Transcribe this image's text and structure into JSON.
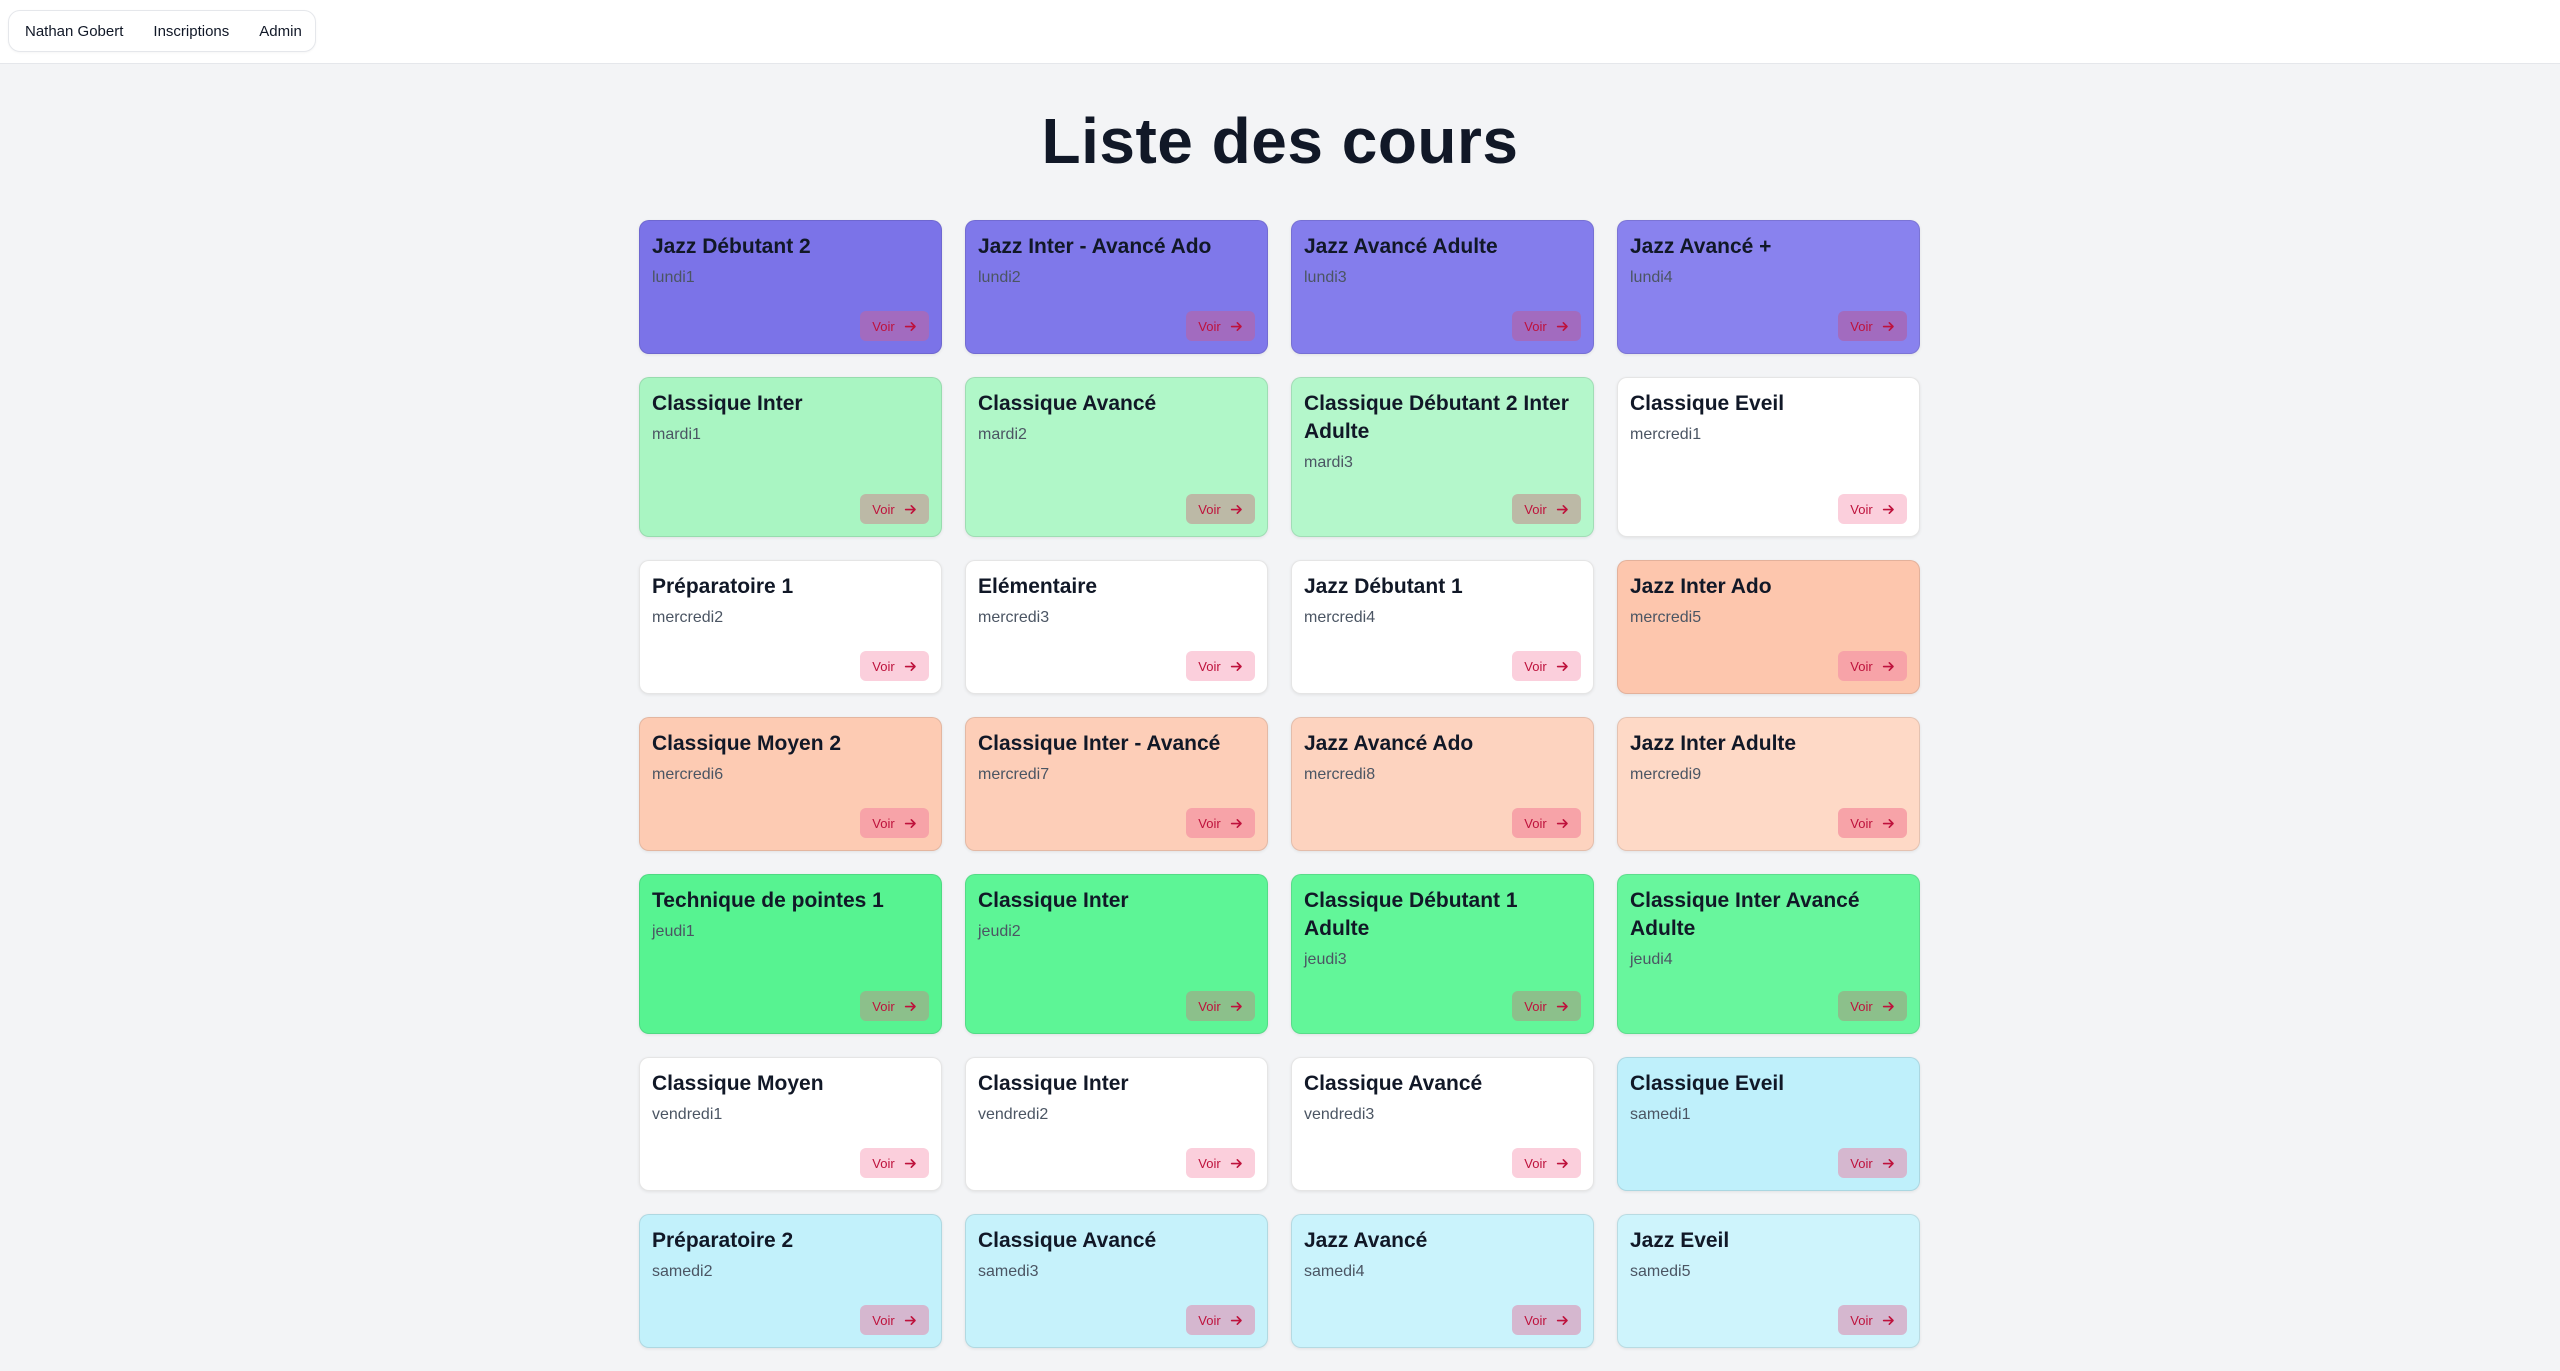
{
  "nav": {
    "items": [
      {
        "label": "Nathan Gobert"
      },
      {
        "label": "Inscriptions"
      },
      {
        "label": "Admin"
      }
    ]
  },
  "page": {
    "title": "Liste des cours"
  },
  "voir_label": "Voir",
  "courses": [
    {
      "title": "Jazz Débutant 2",
      "code": "lundi1",
      "color": "#7b73e8",
      "button_color": "#a26bbf"
    },
    {
      "title": "Jazz Inter - Avancé Ado",
      "code": "lundi2",
      "color": "#7f78ea",
      "button_color": "#a26bbf"
    },
    {
      "title": "Jazz Avancé Adulte",
      "code": "lundi3",
      "color": "#847dec",
      "button_color": "#a26bbf"
    },
    {
      "title": "Jazz Avancé +",
      "code": "lundi4",
      "color": "#8982ee",
      "button_color": "#a26bbf"
    },
    {
      "title": "Classique Inter",
      "code": "mardi1",
      "color": "#a9f5c2",
      "button_color": "#bcb9a6"
    },
    {
      "title": "Classique Avancé",
      "code": "mardi2",
      "color": "#b0f7c8",
      "button_color": "#bcb9a6"
    },
    {
      "title": "Classique Débutant 2 Inter Adulte",
      "code": "mardi3",
      "color": "#b4f7cb",
      "button_color": "#bcb9a6"
    },
    {
      "title": "Classique Eveil",
      "code": "mercredi1",
      "color": "#ffffff",
      "button_color": "#fbcfdc"
    },
    {
      "title": "Préparatoire 1",
      "code": "mercredi2",
      "color": "#ffffff",
      "button_color": "#fbcfdc"
    },
    {
      "title": "Elémentaire",
      "code": "mercredi3",
      "color": "#ffffff",
      "button_color": "#fbcfdc"
    },
    {
      "title": "Jazz Débutant 1",
      "code": "mercredi4",
      "color": "#ffffff",
      "button_color": "#fbcfdc"
    },
    {
      "title": "Jazz Inter Ado",
      "code": "mercredi5",
      "color": "#fdc6ad",
      "button_color": "#f7a3a8"
    },
    {
      "title": "Classique Moyen 2",
      "code": "mercredi6",
      "color": "#fdcbb3",
      "button_color": "#f7a3a8"
    },
    {
      "title": "Classique Inter - Avancé",
      "code": "mercredi7",
      "color": "#fdceb8",
      "button_color": "#f7a3a8"
    },
    {
      "title": "Jazz Avancé Ado",
      "code": "mercredi8",
      "color": "#fdd3bf",
      "button_color": "#f7a3a8"
    },
    {
      "title": "Jazz Inter Adulte",
      "code": "mercredi9",
      "color": "#fed9c6",
      "button_color": "#f7a3a8"
    },
    {
      "title": "Technique de pointes 1",
      "code": "jeudi1",
      "color": "#57f391",
      "button_color": "#8cc08b"
    },
    {
      "title": "Classique Inter",
      "code": "jeudi2",
      "color": "#5df596",
      "button_color": "#8cc08b"
    },
    {
      "title": "Classique Débutant 1 Adulte",
      "code": "jeudi3",
      "color": "#62f699",
      "button_color": "#8cc08b"
    },
    {
      "title": "Classique Inter Avancé Adulte",
      "code": "jeudi4",
      "color": "#68f69d",
      "button_color": "#8cc08b"
    },
    {
      "title": "Classique Moyen",
      "code": "vendredi1",
      "color": "#ffffff",
      "button_color": "#fbcfdc"
    },
    {
      "title": "Classique Inter",
      "code": "vendredi2",
      "color": "#ffffff",
      "button_color": "#fbcfdc"
    },
    {
      "title": "Classique Avancé",
      "code": "vendredi3",
      "color": "#ffffff",
      "button_color": "#fbcfdc"
    },
    {
      "title": "Classique Eveil",
      "code": "samedi1",
      "color": "#bff0fb",
      "button_color": "#d5b7cf"
    },
    {
      "title": "Préparatoire 2",
      "code": "samedi2",
      "color": "#c2f1fb",
      "button_color": "#d5b7cf"
    },
    {
      "title": "Classique Avancé",
      "code": "samedi3",
      "color": "#c6f2fb",
      "button_color": "#d5b7cf"
    },
    {
      "title": "Jazz Avancé",
      "code": "samedi4",
      "color": "#caf3fc",
      "button_color": "#d5b7cf"
    },
    {
      "title": "Jazz Eveil",
      "code": "samedi5",
      "color": "#cef4fc",
      "button_color": "#d5b7cf"
    }
  ]
}
